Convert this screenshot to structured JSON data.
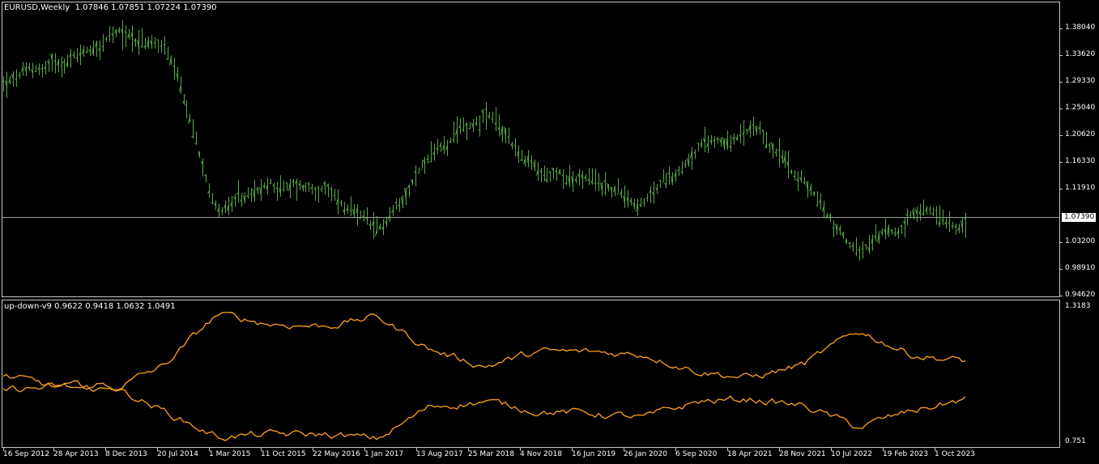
{
  "main_panel": {
    "header": {
      "symbol": "EURUSD,Weekly",
      "ohlc": "1.07846 1.07851 1.07224 1.07390"
    },
    "price_axis": [
      "1.38040",
      "1.33620",
      "1.29330",
      "1.25040",
      "1.20620",
      "1.16330",
      "1.11910",
      "1.03200",
      "0.98910",
      "0.94620"
    ],
    "current_price": "1.07390",
    "colors": {
      "bars": "#57a947",
      "background": "#000000",
      "axis_text": "#ffffff",
      "price_line": "#a0a0a0"
    }
  },
  "indicator_panel": {
    "header": {
      "name": "up-down-v9",
      "values": "0.9622 0.9418 1.0632 1.0491"
    },
    "axis": [
      "1.3183",
      "0.751"
    ],
    "colors": {
      "lines": "#ffa020"
    }
  },
  "time_axis": [
    "16 Sep 2012",
    "28 Apr 2013",
    "8 Dec 2013",
    "20 Jul 2014",
    "1 Mar 2015",
    "11 Oct 2015",
    "22 May 2016",
    "1 Jan 2017",
    "13 Aug 2017",
    "25 Mar 2018",
    "4 Nov 2018",
    "16 Jun 2019",
    "26 Jan 2020",
    "6 Sep 2020",
    "18 Apr 2021",
    "28 Nov 2021",
    "10 Jul 2022",
    "19 Feb 2023",
    "1 Oct 2023"
  ],
  "chart_data": {
    "type": "line",
    "title": "EURUSD,Weekly",
    "x": [
      "16 Sep 2012",
      "28 Apr 2013",
      "8 Dec 2013",
      "20 Jul 2014",
      "1 Mar 2015",
      "11 Oct 2015",
      "22 May 2016",
      "1 Jan 2017",
      "13 Aug 2017",
      "25 Mar 2018",
      "4 Nov 2018",
      "16 Jun 2019",
      "26 Jan 2020",
      "6 Sep 2020",
      "18 Apr 2021",
      "28 Nov 2021",
      "10 Jul 2022",
      "19 Feb 2023",
      "1 Oct 2023"
    ],
    "series": [
      {
        "name": "EURUSD,Weekly",
        "values": [
          1.29,
          1.32,
          1.37,
          1.35,
          1.09,
          1.12,
          1.12,
          1.04,
          1.18,
          1.24,
          1.14,
          1.13,
          1.1,
          1.19,
          1.21,
          1.13,
          1.01,
          1.07,
          1.07
        ]
      },
      {
        "name": "up-down-v9",
        "values": [
          0.97,
          0.98,
          0.97,
          1.07,
          1.29,
          1.25,
          1.24,
          1.28,
          1.14,
          1.07,
          1.13,
          1.13,
          1.12,
          1.05,
          1.02,
          1.08,
          1.22,
          1.12,
          1.09
        ]
      },
      {
        "values": [
          1.03,
          0.98,
          0.99,
          0.88,
          0.77,
          0.78,
          0.78,
          0.76,
          0.9,
          0.92,
          0.88,
          0.87,
          0.85,
          0.92,
          0.93,
          0.9,
          0.81,
          0.88,
          0.93
        ]
      }
    ],
    "ylim": [
      0.9462,
      1.3804
    ],
    "ylim_indicator": [
      0.751,
      1.3183
    ],
    "grid": false,
    "close_line": 1.0739
  }
}
